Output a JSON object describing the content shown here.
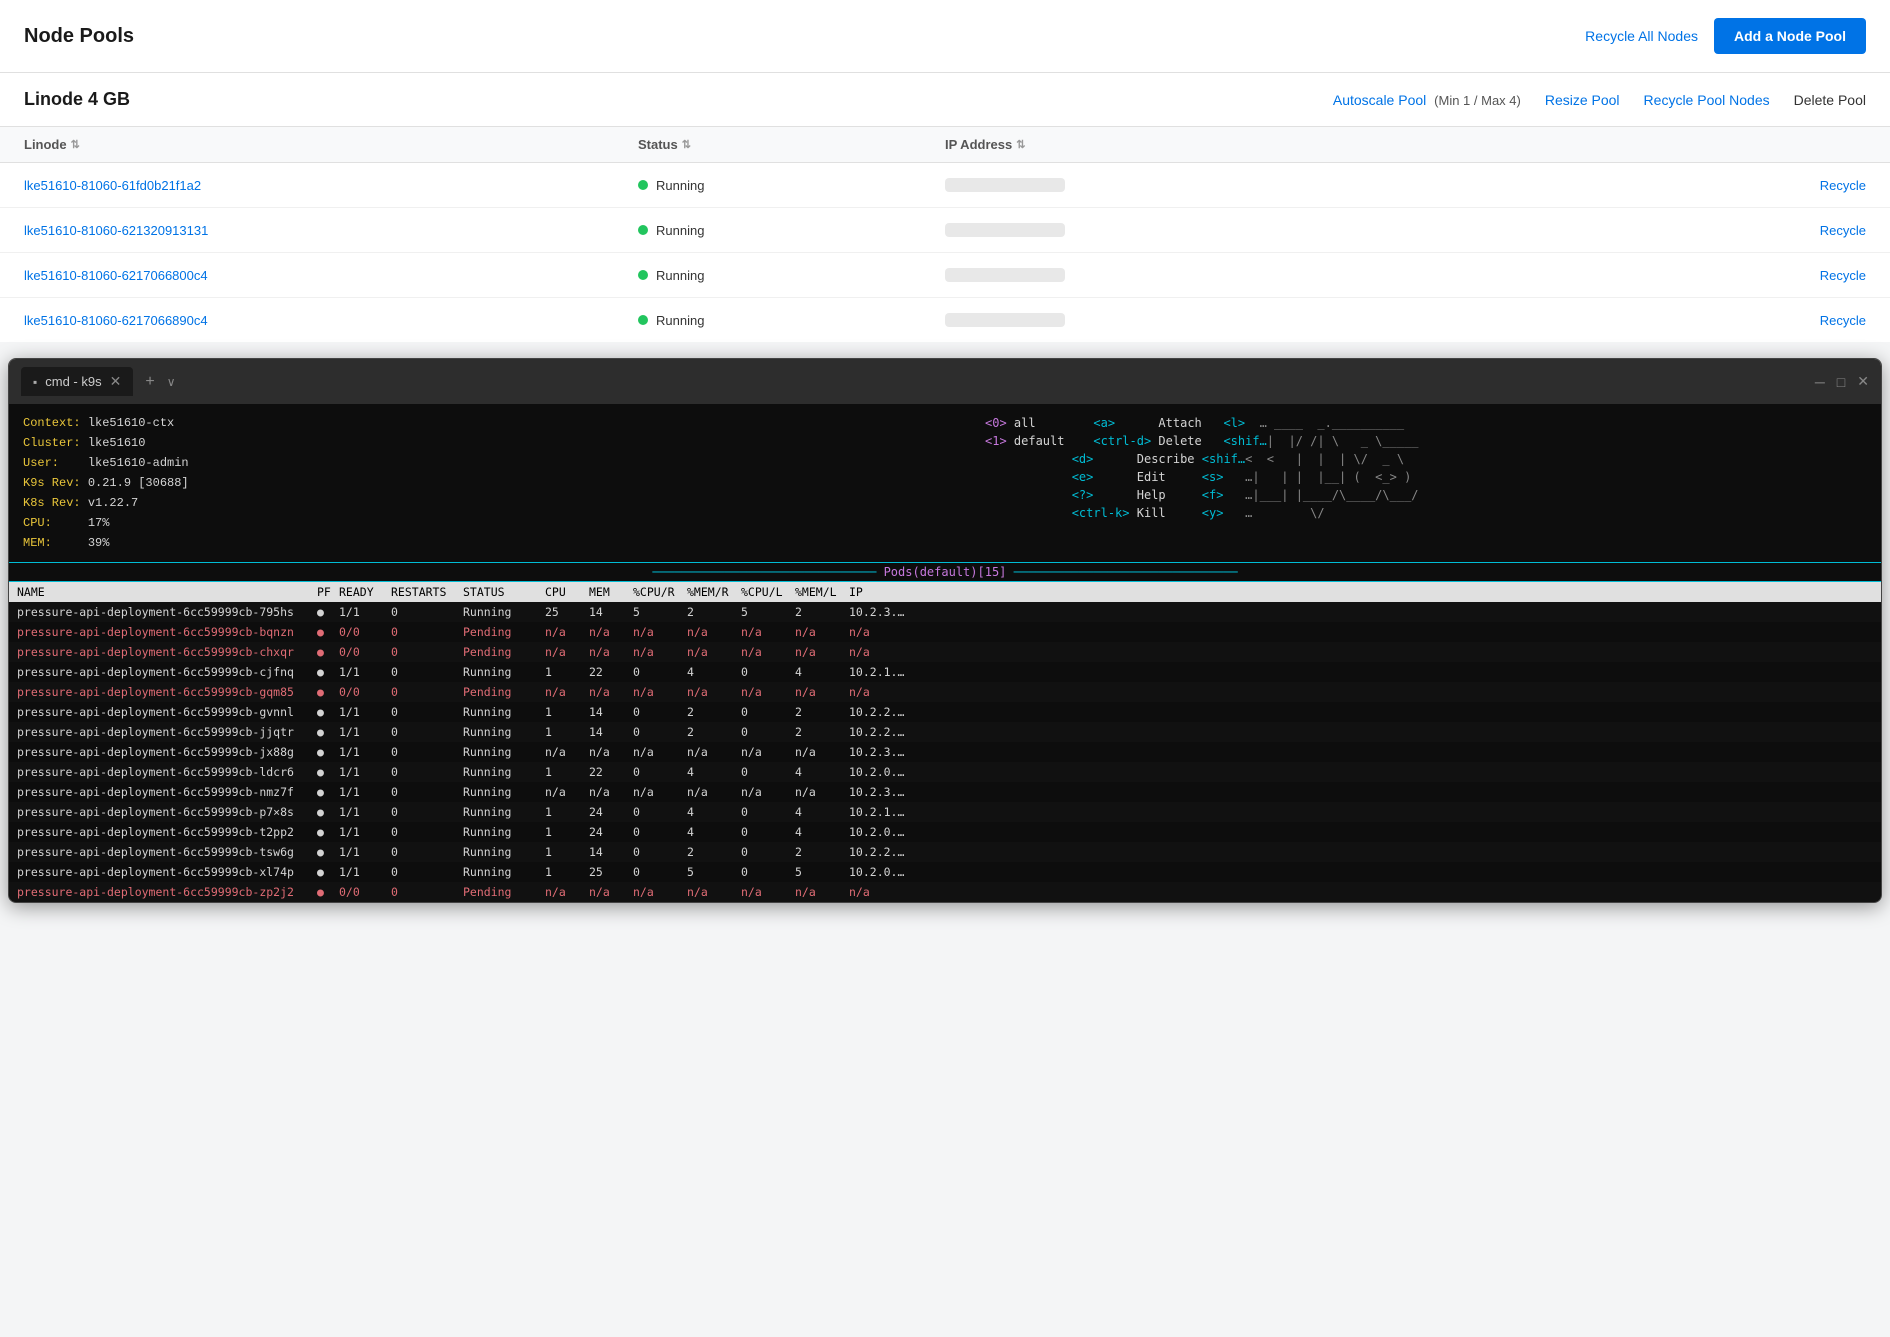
{
  "header": {
    "title": "Node Pools",
    "recycle_all_label": "Recycle All Nodes",
    "add_pool_label": "Add a Node Pool"
  },
  "pool": {
    "title": "Linode 4 GB",
    "autoscale_label": "Autoscale Pool",
    "autoscale_meta": "(Min 1 / Max 4)",
    "resize_label": "Resize Pool",
    "recycle_nodes_label": "Recycle Pool Nodes",
    "delete_label": "Delete Pool"
  },
  "table": {
    "col_linode": "Linode",
    "col_status": "Status",
    "col_ip": "IP Address",
    "col_action": "",
    "rows": [
      {
        "id": "lke51610-81060-61fd0b21f1a2",
        "status": "Running",
        "recycle": "Recycle"
      },
      {
        "id": "lke51610-81060-621320913131",
        "status": "Running",
        "recycle": "Recycle"
      },
      {
        "id": "lke51610-81060-6217066800c4",
        "status": "Running",
        "recycle": "Recycle"
      },
      {
        "id": "lke51610-81060-6217066890c4",
        "status": "Running",
        "recycle": "Recycle"
      }
    ]
  },
  "terminal": {
    "tab_icon": "▪",
    "tab_title": "cmd - k9s",
    "context_label": "Context:",
    "context_val": "lke51610-ctx",
    "cluster_label": "Cluster:",
    "cluster_val": "lke51610",
    "user_label": "User:",
    "user_val": "lke51610-admin",
    "k9s_rev_label": "K9s Rev:",
    "k9s_rev_val": "0.21.9 [30688]",
    "k8s_rev_label": "K8s Rev:",
    "k8s_rev_val": "v1.22.7",
    "cpu_label": "CPU:",
    "cpu_val": "17%",
    "mem_label": "MEM:",
    "mem_val": "39%",
    "divider_text": "─────────────────────────── Pods(default)[15] ──────────────────────────────",
    "pods_title": "Pods(default)[15]",
    "shortcut_block": "<0> all       <a>      Attach   <l>   … ____ _.__________\n<1> default   <ctrl-d> Delete   <shif…|  |/ /| \\   _ \\_____\n              <d>      Describe <shif…<  <   |  |  | \\/  _ \\\n              <e>      Edit     <s>   …|   | |  |__| (  <_> )\n              <?> Help          <f>   …|___| |____/\\____/\\___/\n              <ctrl-k> Kill     <y>   …        \\/",
    "table_headers": [
      "NAME",
      "PF",
      "READY",
      "RESTARTS",
      "STATUS",
      "CPU",
      "MEM",
      "%CPU/R",
      "%MEM/R",
      "%CPU/L",
      "%MEM/L",
      "IP"
    ],
    "pods": [
      {
        "name": "pressure-api-deployment-6cc59999cb-795hs",
        "pf": "●",
        "ready": "1/1",
        "restarts": "0",
        "status": "Running",
        "cpu": "25",
        "mem": "14",
        "cpuR": "5",
        "memR": "2",
        "cpuL": "5",
        "memL": "2",
        "ip": "10.2.3.…",
        "pending": false
      },
      {
        "name": "pressure-api-deployment-6cc59999cb-bqnzn",
        "pf": "●",
        "ready": "0/0",
        "restarts": "0",
        "status": "Pending",
        "cpu": "n/a",
        "mem": "n/a",
        "cpuR": "n/a",
        "memR": "n/a",
        "cpuL": "n/a",
        "memL": "n/a",
        "ip": "n/a",
        "pending": true
      },
      {
        "name": "pressure-api-deployment-6cc59999cb-chxqr",
        "pf": "●",
        "ready": "0/0",
        "restarts": "0",
        "status": "Pending",
        "cpu": "n/a",
        "mem": "n/a",
        "cpuR": "n/a",
        "memR": "n/a",
        "cpuL": "n/a",
        "memL": "n/a",
        "ip": "n/a",
        "pending": true
      },
      {
        "name": "pressure-api-deployment-6cc59999cb-cjfnq",
        "pf": "●",
        "ready": "1/1",
        "restarts": "0",
        "status": "Running",
        "cpu": "1",
        "mem": "22",
        "cpuR": "0",
        "memR": "4",
        "cpuL": "0",
        "memL": "4",
        "ip": "10.2.1.…",
        "pending": false
      },
      {
        "name": "pressure-api-deployment-6cc59999cb-gqm85",
        "pf": "●",
        "ready": "0/0",
        "restarts": "0",
        "status": "Pending",
        "cpu": "n/a",
        "mem": "n/a",
        "cpuR": "n/a",
        "memR": "n/a",
        "cpuL": "n/a",
        "memL": "n/a",
        "ip": "n/a",
        "pending": true
      },
      {
        "name": "pressure-api-deployment-6cc59999cb-gvnnl",
        "pf": "●",
        "ready": "1/1",
        "restarts": "0",
        "status": "Running",
        "cpu": "1",
        "mem": "14",
        "cpuR": "0",
        "memR": "2",
        "cpuL": "0",
        "memL": "2",
        "ip": "10.2.2.…",
        "pending": false
      },
      {
        "name": "pressure-api-deployment-6cc59999cb-jjqtr",
        "pf": "●",
        "ready": "1/1",
        "restarts": "0",
        "status": "Running",
        "cpu": "1",
        "mem": "14",
        "cpuR": "0",
        "memR": "2",
        "cpuL": "0",
        "memL": "2",
        "ip": "10.2.2.…",
        "pending": false
      },
      {
        "name": "pressure-api-deployment-6cc59999cb-jx88g",
        "pf": "●",
        "ready": "1/1",
        "restarts": "0",
        "status": "Running",
        "cpu": "n/a",
        "mem": "n/a",
        "cpuR": "n/a",
        "memR": "n/a",
        "cpuL": "n/a",
        "memL": "n/a",
        "ip": "10.2.3.…",
        "pending": false
      },
      {
        "name": "pressure-api-deployment-6cc59999cb-ldcr6",
        "pf": "●",
        "ready": "1/1",
        "restarts": "0",
        "status": "Running",
        "cpu": "1",
        "mem": "22",
        "cpuR": "0",
        "memR": "4",
        "cpuL": "0",
        "memL": "4",
        "ip": "10.2.0.…",
        "pending": false
      },
      {
        "name": "pressure-api-deployment-6cc59999cb-nmz7f",
        "pf": "●",
        "ready": "1/1",
        "restarts": "0",
        "status": "Running",
        "cpu": "n/a",
        "mem": "n/a",
        "cpuR": "n/a",
        "memR": "n/a",
        "cpuL": "n/a",
        "memL": "n/a",
        "ip": "10.2.3.…",
        "pending": false
      },
      {
        "name": "pressure-api-deployment-6cc59999cb-p7×8s",
        "pf": "●",
        "ready": "1/1",
        "restarts": "0",
        "status": "Running",
        "cpu": "1",
        "mem": "24",
        "cpuR": "0",
        "memR": "4",
        "cpuL": "0",
        "memL": "4",
        "ip": "10.2.1.…",
        "pending": false
      },
      {
        "name": "pressure-api-deployment-6cc59999cb-t2pp2",
        "pf": "●",
        "ready": "1/1",
        "restarts": "0",
        "status": "Running",
        "cpu": "1",
        "mem": "24",
        "cpuR": "0",
        "memR": "4",
        "cpuL": "0",
        "memL": "4",
        "ip": "10.2.0.…",
        "pending": false
      },
      {
        "name": "pressure-api-deployment-6cc59999cb-tsw6g",
        "pf": "●",
        "ready": "1/1",
        "restarts": "0",
        "status": "Running",
        "cpu": "1",
        "mem": "14",
        "cpuR": "0",
        "memR": "2",
        "cpuL": "0",
        "memL": "2",
        "ip": "10.2.2.…",
        "pending": false
      },
      {
        "name": "pressure-api-deployment-6cc59999cb-xl74p",
        "pf": "●",
        "ready": "1/1",
        "restarts": "0",
        "status": "Running",
        "cpu": "1",
        "mem": "25",
        "cpuR": "0",
        "memR": "5",
        "cpuL": "0",
        "memL": "5",
        "ip": "10.2.0.…",
        "pending": false
      },
      {
        "name": "pressure-api-deployment-6cc59999cb-zp2j2",
        "pf": "●",
        "ready": "0/0",
        "restarts": "0",
        "status": "Pending",
        "cpu": "n/a",
        "mem": "n/a",
        "cpuR": "n/a",
        "memR": "n/a",
        "cpuL": "n/a",
        "memL": "n/a",
        "ip": "n/a",
        "pending": true
      }
    ]
  }
}
